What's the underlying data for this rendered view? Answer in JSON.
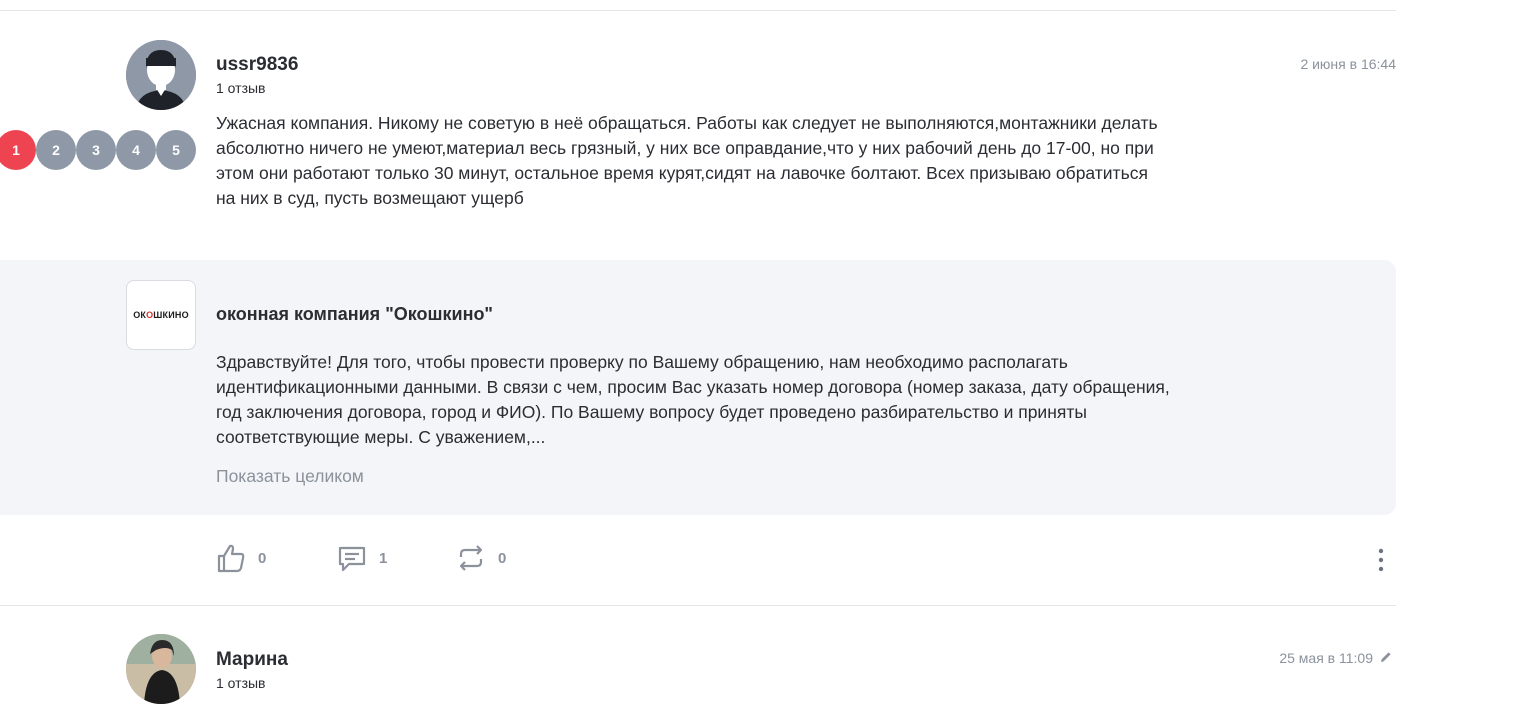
{
  "review1": {
    "username": "ussr9836",
    "review_count": "1 отзыв",
    "date": "2 июня в 16:44",
    "ratings": [
      "1",
      "2",
      "3",
      "4",
      "5"
    ],
    "active_rating": 1,
    "text": "Ужасная компания. Никому не советую в неё обращаться. Работы как следует не выполняются,монтажники делать абсолютно ничего не умеют,материал весь грязный, у них все оправдание,что у них рабочий день до 17-00, но при этом они работают только 30 минут, остальное время курят,сидят на лавочке болтают. Всех призываю обратиться на них в суд, пусть возмещают ущерб"
  },
  "reply": {
    "logo_text_part1": "ОК",
    "logo_text_o": "О",
    "logo_text_part2": "ШКИНО",
    "company_name": "оконная компания \"Окошкино\"",
    "text": "Здравствуйте! Для того, чтобы провести проверку по Вашему обращению, нам необходимо располагать идентификационными данными. В связи с чем, просим Вас указать номер договора (номер заказа, дату обращения, год заключения договора, город и ФИО). По Вашему вопросу будет проведено разбирательство и приняты соответствующие меры. С уважением,...",
    "show_full": "Показать целиком"
  },
  "actions": {
    "likes": "0",
    "comments": "1",
    "reposts": "0"
  },
  "review2": {
    "username": "Марина",
    "review_count": "1 отзыв",
    "date": "25 мая в 11:09"
  },
  "colors": {
    "accent_red": "#ee4451",
    "rating_gray": "#8e98a6",
    "muted_text": "#8b929c",
    "reply_bg": "#f3f5f8"
  }
}
